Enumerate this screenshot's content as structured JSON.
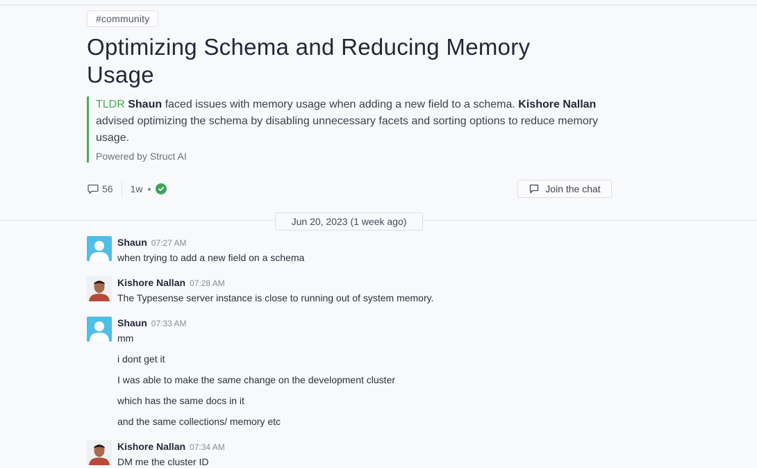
{
  "tag": "#community",
  "title": "Optimizing Schema and Reducing Memory Usage",
  "tldr": {
    "label": "TLDR",
    "name1": "Shaun",
    "text1": " faced issues with memory usage when adding a new field to a schema. ",
    "name2": "Kishore Nallan",
    "text2": " advised optimizing the schema by disabling unnecessary facets and sorting options to reduce memory usage.",
    "powered": "Powered by Struct AI"
  },
  "meta": {
    "replies": "56",
    "age": "1w",
    "bullet": "•",
    "resolved_color": "#3da45a"
  },
  "join_label": "Join the chat",
  "date_divider": "Jun 20, 2023 (1 week ago)",
  "messages": [
    {
      "author": "Shaun",
      "time": "07:27 AM",
      "text": "when trying to add a new field on a schema",
      "avatar": "user-placeholder-icon"
    },
    {
      "author": "Kishore Nallan",
      "time": "07:28 AM",
      "text": "The Typesense server instance is close to running out of system memory.",
      "avatar": "kishore-photo"
    },
    {
      "author": "Shaun",
      "time": "07:33 AM",
      "text": "mm",
      "avatar": "user-placeholder-icon"
    },
    {
      "author": "Kishore Nallan",
      "time": "07:34 AM",
      "text": "DM me the cluster ID",
      "avatar": "kishore-photo"
    }
  ],
  "continuations": [
    "i dont get it",
    "I was able to make the same change on the development cluster",
    "which has the same docs in it",
    "and the same collections/ memory etc"
  ]
}
